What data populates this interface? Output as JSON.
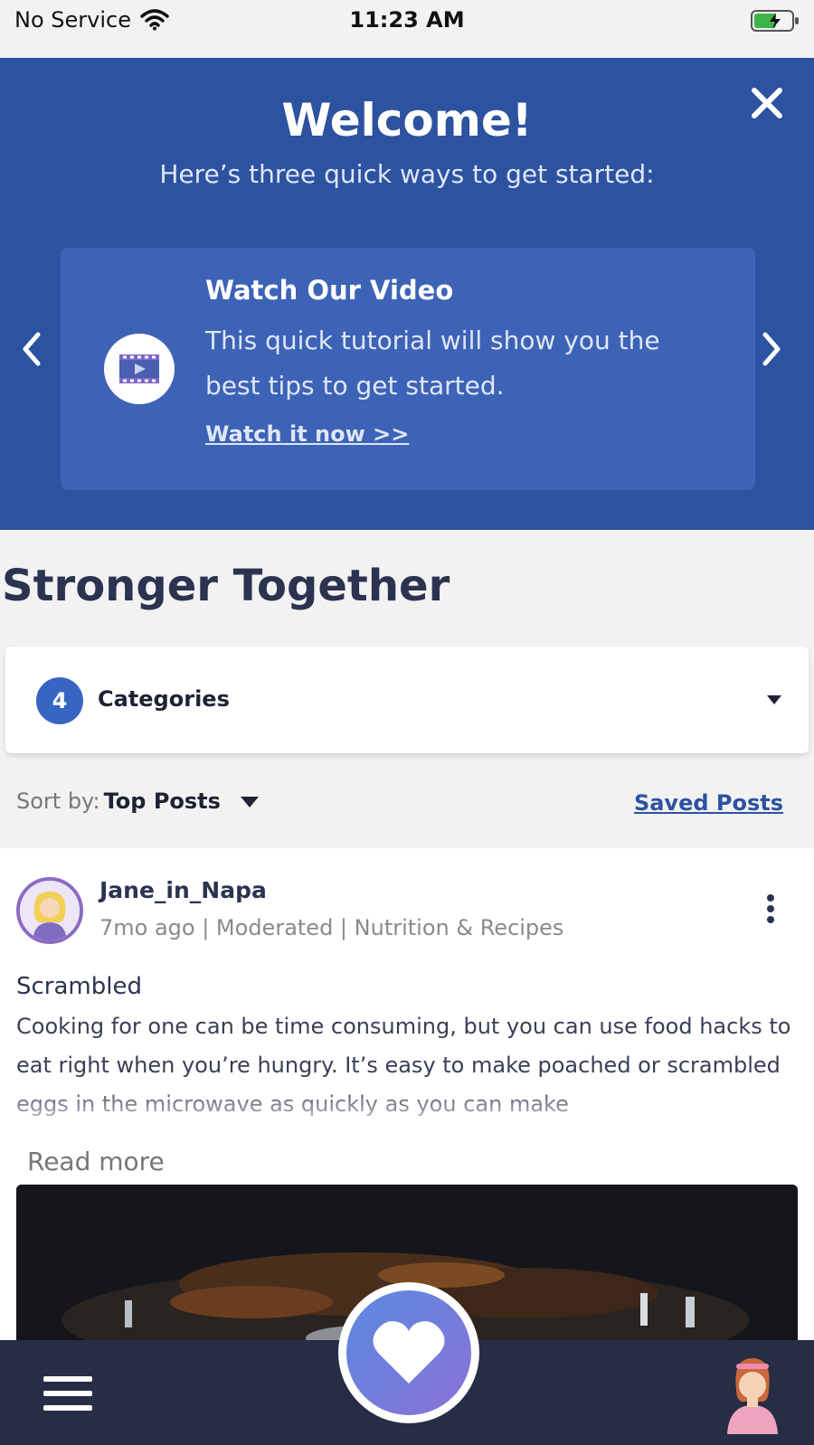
{
  "status_bar": {
    "carrier": "No Service",
    "time": "11:23 AM"
  },
  "welcome": {
    "title": "Welcome!",
    "subtitle": "Here’s three quick ways to get started:",
    "card": {
      "title": "Watch Our Video",
      "description": "This quick tutorial will show you the best tips to get started.",
      "link": "Watch it now >>"
    }
  },
  "community": {
    "title": "Stronger Together",
    "categories": {
      "count": "4",
      "label": "Categories"
    },
    "sort": {
      "label": "Sort by:",
      "value": "Top Posts"
    },
    "saved_link": "Saved Posts"
  },
  "post": {
    "author": "Jane_in_Napa",
    "meta": "7mo ago | Moderated | Nutrition & Recipes",
    "title": "Scrambled",
    "body": "Cooking for one can be time consuming, but you can use food hacks to eat right when you’re hungry. It’s easy to make poached or scrambled eggs in the microwave as quickly as you can make",
    "read_more": "Read more"
  },
  "colors": {
    "banner": "#2c52a0",
    "card": "#3d63b6",
    "accent": "#3766c2",
    "bottom_bar": "#262d45"
  },
  "icons": [
    "wifi-icon",
    "battery-icon",
    "close-icon",
    "chevron-left-icon",
    "chevron-right-icon",
    "video-icon",
    "chevron-down-icon",
    "more-vertical-icon",
    "menu-icon",
    "heart-icon",
    "profile-icon"
  ]
}
